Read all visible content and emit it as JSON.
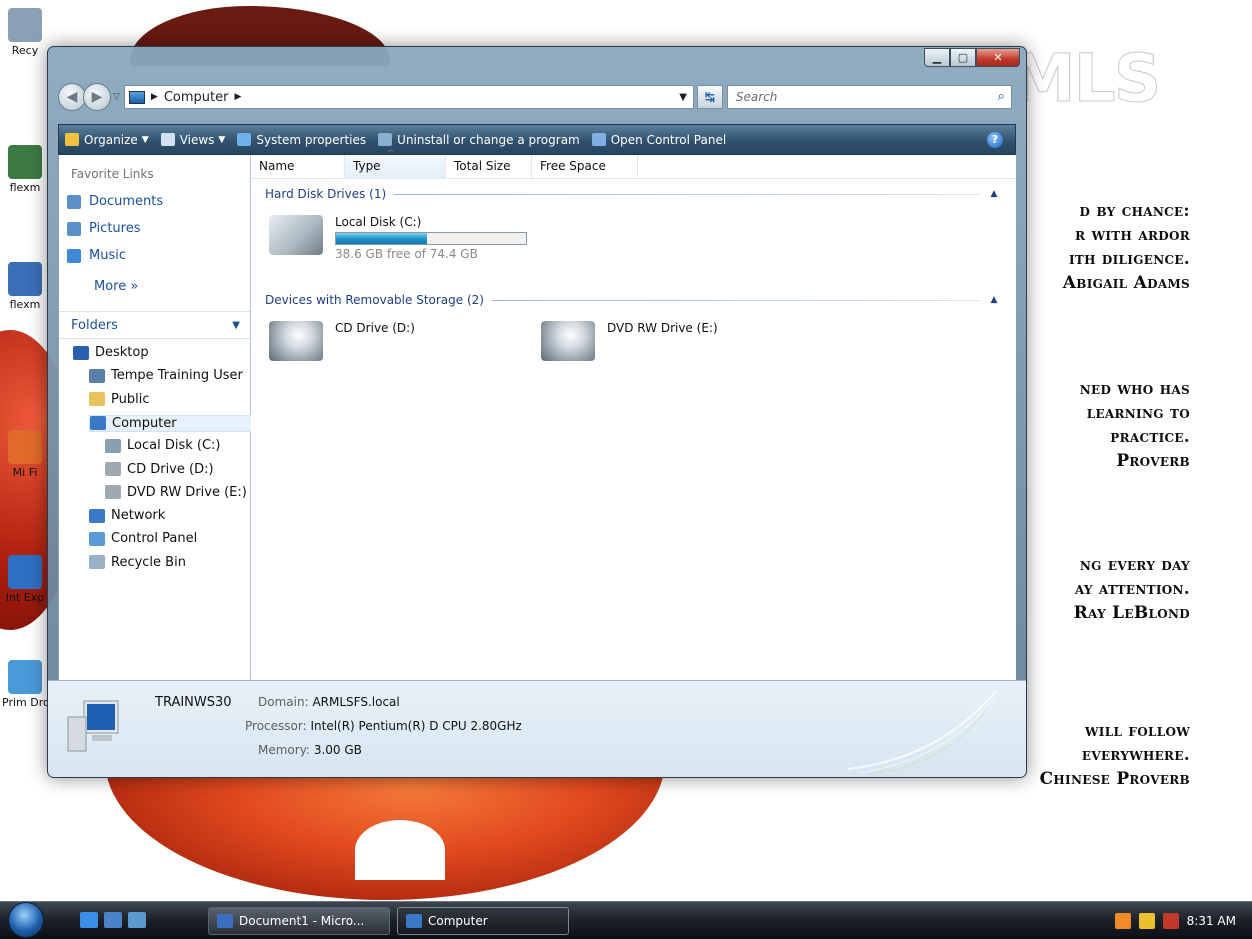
{
  "desktop": {
    "logo_text": "MLS",
    "icons": [
      {
        "label": "Recy",
        "color": "#8aa0b5"
      },
      {
        "label": "flexm",
        "color": "#3e7a44"
      },
      {
        "label": "flexm",
        "color": "#3b6fb6"
      },
      {
        "label": "Mi Fi",
        "color": "#e06a2a"
      },
      {
        "label": "Int Exp",
        "color": "#2f6fc2"
      },
      {
        "label": "Prim Drop",
        "color": "#4a9ad8"
      }
    ],
    "quotes": [
      {
        "lines": [
          "d by chance:",
          "r with ardor",
          "ith diligence.",
          "Abigail Adams"
        ]
      },
      {
        "lines": [
          "ned who has",
          "learning to",
          "practice.",
          "Proverb"
        ]
      },
      {
        "lines": [
          "ng every day",
          "ay attention.",
          "Ray LeBlond"
        ]
      },
      {
        "lines": [
          "will follow",
          "everywhere.",
          "Chinese Proverb"
        ]
      }
    ]
  },
  "window": {
    "address": {
      "location": "Computer"
    },
    "search_placeholder": "Search",
    "toolbar": [
      {
        "label": "Organize",
        "icon": "organize-icon",
        "dropdown": true,
        "color": "#f0c040"
      },
      {
        "label": "Views",
        "icon": "views-icon",
        "dropdown": true,
        "color": "#cfe0f0"
      },
      {
        "label": "System properties",
        "icon": "system-properties-icon",
        "dropdown": false,
        "color": "#6fb0e8"
      },
      {
        "label": "Uninstall or change a program",
        "icon": "uninstall-icon",
        "dropdown": false,
        "color": "#8ab0d0"
      },
      {
        "label": "Open Control Panel",
        "icon": "control-panel-icon",
        "dropdown": false,
        "color": "#7fb0e0"
      }
    ],
    "favorites": {
      "title": "Favorite Links",
      "items": [
        {
          "label": "Documents",
          "color": "#5a8fc8"
        },
        {
          "label": "Pictures",
          "color": "#5a8fc8"
        },
        {
          "label": "Music",
          "color": "#3f88d8"
        }
      ],
      "more_label": "More"
    },
    "folders": {
      "title": "Folders",
      "tree": [
        {
          "label": "Desktop",
          "indent": 0,
          "color": "#2a5fb0"
        },
        {
          "label": "Tempe Training User",
          "indent": 1,
          "color": "#5a7fa8"
        },
        {
          "label": "Public",
          "indent": 1,
          "color": "#e8c25a"
        },
        {
          "label": "Computer",
          "indent": 1,
          "color": "#3a78c8",
          "selected": true
        },
        {
          "label": "Local Disk (C:)",
          "indent": 2,
          "color": "#8aa0b0"
        },
        {
          "label": "CD Drive (D:)",
          "indent": 2,
          "color": "#a0a8b0"
        },
        {
          "label": "DVD RW Drive (E:)",
          "indent": 2,
          "color": "#a0a8b0"
        },
        {
          "label": "Network",
          "indent": 1,
          "color": "#3a78c8"
        },
        {
          "label": "Control Panel",
          "indent": 1,
          "color": "#5a9ad8"
        },
        {
          "label": "Recycle Bin",
          "indent": 1,
          "color": "#9ab0c8"
        }
      ]
    },
    "columns": [
      "Name",
      "Type",
      "Total Size",
      "Free Space"
    ],
    "sorted_column": "Type",
    "groups": [
      {
        "title": "Hard Disk Drives (1)",
        "items": [
          {
            "name": "Local Disk (C:)",
            "free_text": "38.6 GB free of 74.4 GB",
            "used_fraction": 0.48
          }
        ]
      },
      {
        "title": "Devices with Removable Storage (2)",
        "items": [
          {
            "name": "CD Drive (D:)"
          },
          {
            "name": "DVD RW Drive (E:)"
          }
        ]
      }
    ],
    "details": {
      "machine_name": "TRAINWS30",
      "domain_label": "Domain:",
      "domain_value": "ARMLSFS.local",
      "processor_label": "Processor:",
      "processor_value": "Intel(R) Pentium(R) D CPU 2.80GHz",
      "memory_label": "Memory:",
      "memory_value": "3.00 GB"
    }
  },
  "taskbar": {
    "tasks": [
      {
        "label": "Document1 - Micro...",
        "color": "#3a6fc0",
        "active": false
      },
      {
        "label": "Computer",
        "color": "#3a78c8",
        "active": true
      }
    ],
    "clock": "8:31 AM",
    "quick_launch": [
      {
        "name": "ie-icon",
        "color": "#3b8ee8"
      },
      {
        "name": "show-desktop-icon",
        "color": "#4a82c8"
      },
      {
        "name": "switch-windows-icon",
        "color": "#5a9ad0"
      }
    ],
    "tray_icons": [
      {
        "name": "tray-app-icon",
        "color": "#f08a2a"
      },
      {
        "name": "tray-security-icon",
        "color": "#e8c030"
      },
      {
        "name": "volume-muted-icon",
        "color": "#c0392b"
      }
    ]
  }
}
